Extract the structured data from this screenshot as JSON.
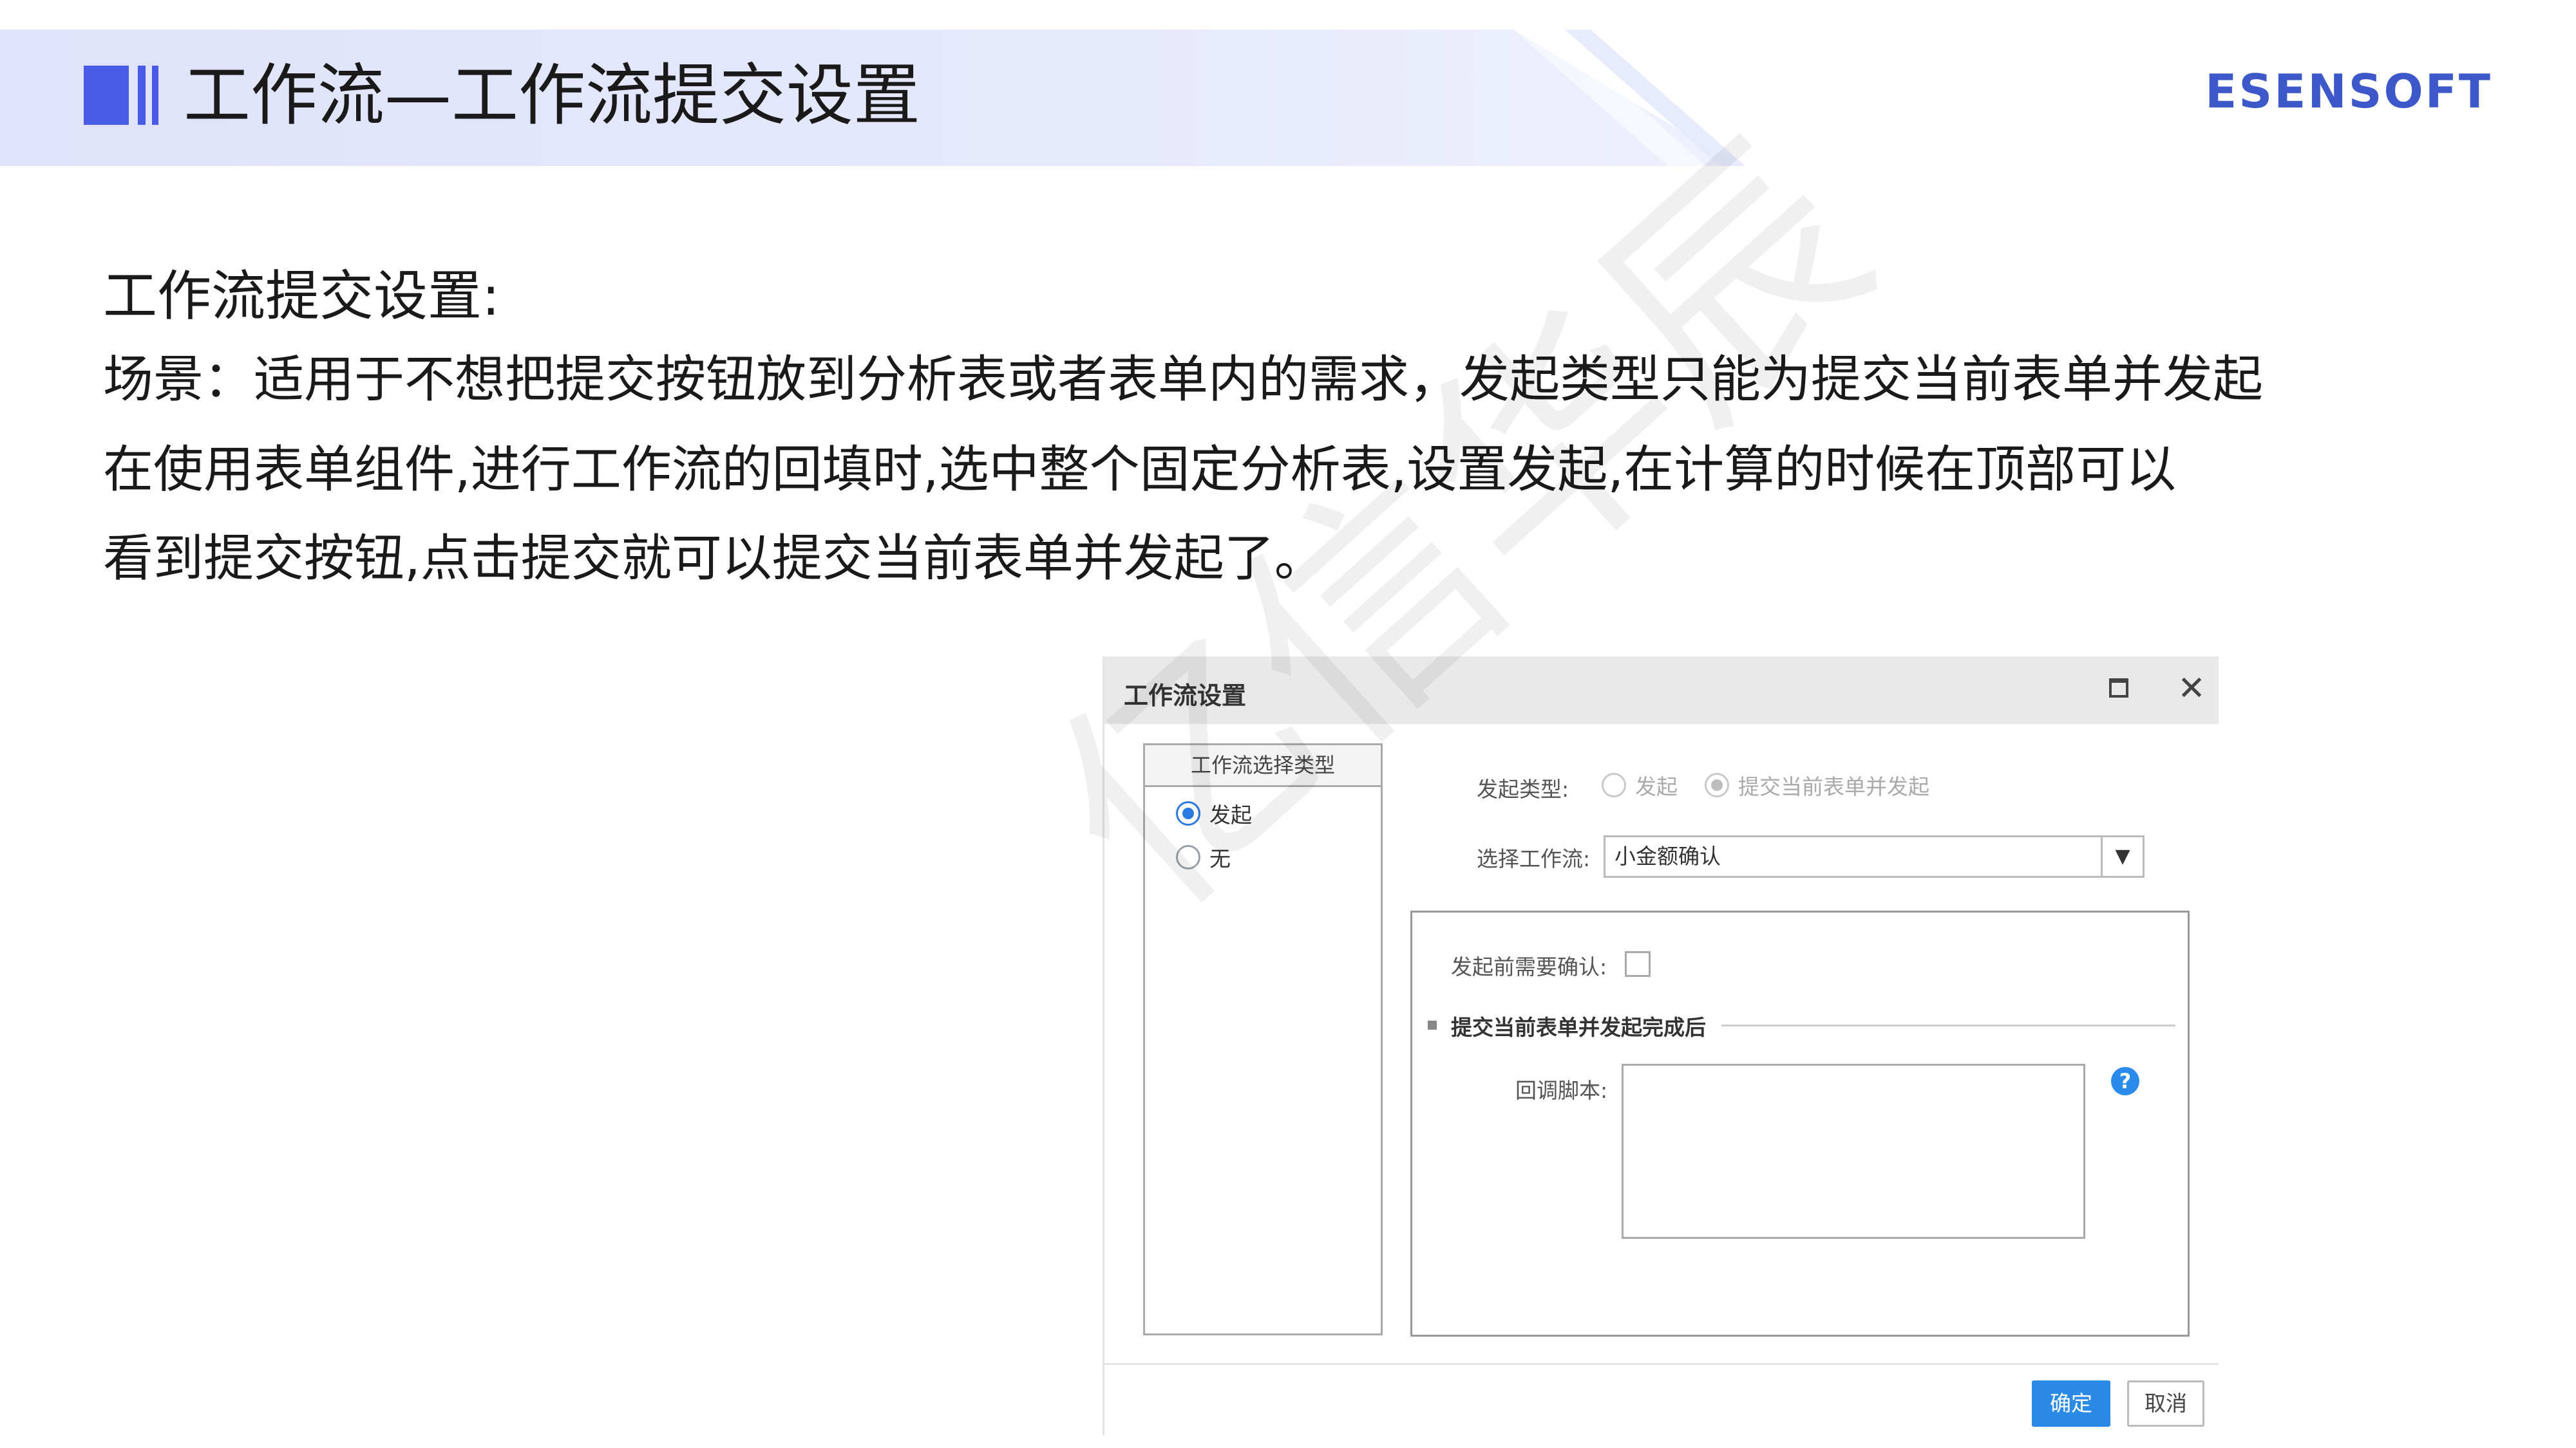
{
  "header": {
    "title": "工作流—工作流提交设置",
    "brand": "ESENSOFT"
  },
  "content": {
    "section_title": "工作流提交设置:",
    "lines": [
      "场景：适用于不想把提交按钮放到分析表或者表单内的需求，发起类型只能为提交当前表单并发起",
      "在使用表单组件,进行工作流的回填时,选中整个固定分析表,设置发起,在计算的时候在顶部可以",
      "看到提交按钮,点击提交就可以提交当前表单并发起了。"
    ]
  },
  "watermark": "亿信华辰",
  "dialog": {
    "title": "工作流设置",
    "left_panel": {
      "header": "工作流选择类型",
      "options": [
        {
          "label": "发起",
          "checked": true
        },
        {
          "label": "无",
          "checked": false
        }
      ]
    },
    "launch_type": {
      "label": "发起类型:",
      "options": [
        {
          "label": "发起",
          "checked": false
        },
        {
          "label": "提交当前表单并发起",
          "checked": true
        }
      ]
    },
    "select_workflow": {
      "label": "选择工作流:",
      "value": "小金额确认"
    },
    "confirm_before_launch": {
      "label": "发起前需要确认:",
      "checked": false
    },
    "after_section": {
      "title": "提交当前表单并发起完成后",
      "callback_label": "回调脚本:",
      "callback_value": ""
    },
    "buttons": {
      "ok": "确定",
      "cancel": "取消"
    }
  },
  "colors": {
    "accent": "#4a5ae8",
    "brand": "#3c58c9",
    "primary_button": "#2b8ae6"
  }
}
